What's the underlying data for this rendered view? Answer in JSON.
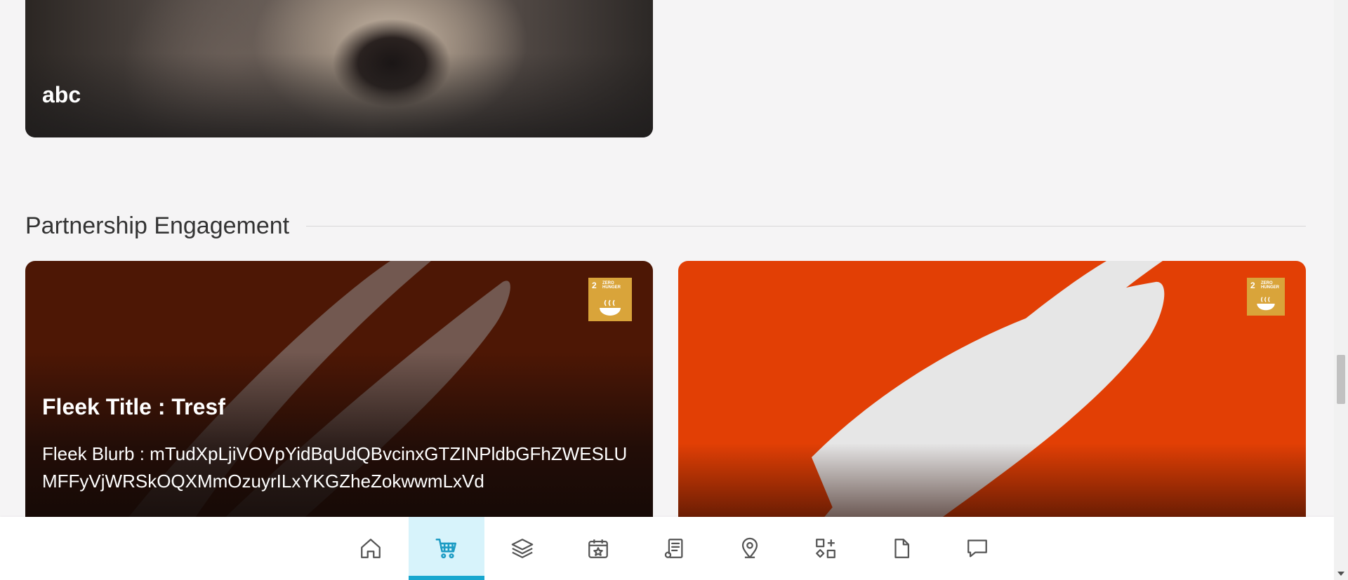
{
  "featured_card": {
    "title": "abc"
  },
  "section": {
    "title": "Partnership Engagement"
  },
  "fleek_cards": [
    {
      "title": "Fleek Title : Tresf",
      "blurb": "Fleek Blurb : mTudXpLjiVOVpYidBqUdQBvcinxGTZINPldbGFhZWESLUMFFyVjWRSkOQXMmOzuyrILxYKGZheZokwwmLxVd",
      "badge": {
        "number": "2",
        "label": "ZERO HUNGER"
      }
    },
    {
      "badge": {
        "number": "2",
        "label": "ZERO HUNGER"
      }
    }
  ],
  "bottom_nav": {
    "items": [
      {
        "icon": "home-icon"
      },
      {
        "icon": "cart-icon",
        "active": true
      },
      {
        "icon": "layers-icon"
      },
      {
        "icon": "calendar-star-icon"
      },
      {
        "icon": "document-list-icon"
      },
      {
        "icon": "location-pin-icon"
      },
      {
        "icon": "apps-add-icon"
      },
      {
        "icon": "file-icon"
      },
      {
        "icon": "chat-icon"
      }
    ]
  },
  "colors": {
    "accent": "#18a7cf",
    "active_bg": "#d7f3fb",
    "card_left": "#4d1705",
    "card_right": "#e23f05",
    "sdg_badge": "#d9a43a"
  }
}
